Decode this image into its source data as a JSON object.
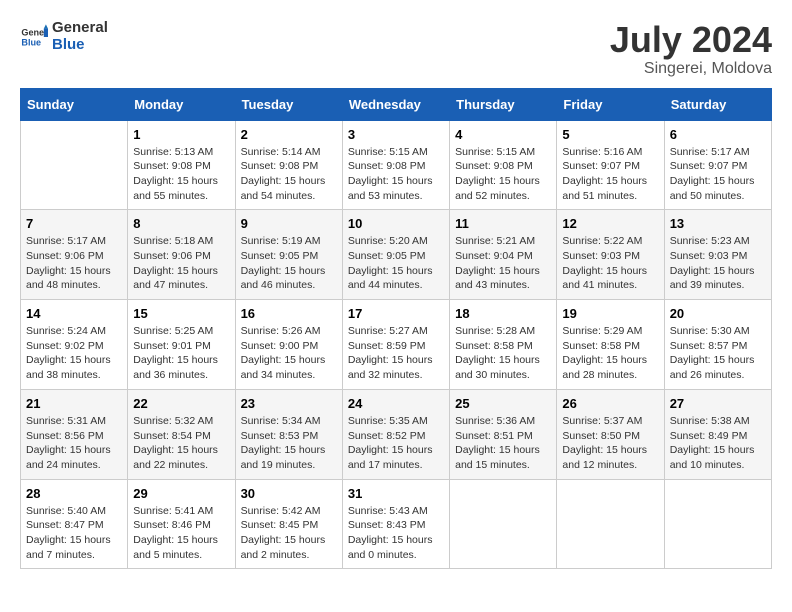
{
  "logo": {
    "general": "General",
    "blue": "Blue"
  },
  "title": "July 2024",
  "subtitle": "Singerei, Moldova",
  "days_header": [
    "Sunday",
    "Monday",
    "Tuesday",
    "Wednesday",
    "Thursday",
    "Friday",
    "Saturday"
  ],
  "weeks": [
    [
      {
        "day": "",
        "info": ""
      },
      {
        "day": "1",
        "info": "Sunrise: 5:13 AM\nSunset: 9:08 PM\nDaylight: 15 hours\nand 55 minutes."
      },
      {
        "day": "2",
        "info": "Sunrise: 5:14 AM\nSunset: 9:08 PM\nDaylight: 15 hours\nand 54 minutes."
      },
      {
        "day": "3",
        "info": "Sunrise: 5:15 AM\nSunset: 9:08 PM\nDaylight: 15 hours\nand 53 minutes."
      },
      {
        "day": "4",
        "info": "Sunrise: 5:15 AM\nSunset: 9:08 PM\nDaylight: 15 hours\nand 52 minutes."
      },
      {
        "day": "5",
        "info": "Sunrise: 5:16 AM\nSunset: 9:07 PM\nDaylight: 15 hours\nand 51 minutes."
      },
      {
        "day": "6",
        "info": "Sunrise: 5:17 AM\nSunset: 9:07 PM\nDaylight: 15 hours\nand 50 minutes."
      }
    ],
    [
      {
        "day": "7",
        "info": "Sunrise: 5:17 AM\nSunset: 9:06 PM\nDaylight: 15 hours\nand 48 minutes."
      },
      {
        "day": "8",
        "info": "Sunrise: 5:18 AM\nSunset: 9:06 PM\nDaylight: 15 hours\nand 47 minutes."
      },
      {
        "day": "9",
        "info": "Sunrise: 5:19 AM\nSunset: 9:05 PM\nDaylight: 15 hours\nand 46 minutes."
      },
      {
        "day": "10",
        "info": "Sunrise: 5:20 AM\nSunset: 9:05 PM\nDaylight: 15 hours\nand 44 minutes."
      },
      {
        "day": "11",
        "info": "Sunrise: 5:21 AM\nSunset: 9:04 PM\nDaylight: 15 hours\nand 43 minutes."
      },
      {
        "day": "12",
        "info": "Sunrise: 5:22 AM\nSunset: 9:03 PM\nDaylight: 15 hours\nand 41 minutes."
      },
      {
        "day": "13",
        "info": "Sunrise: 5:23 AM\nSunset: 9:03 PM\nDaylight: 15 hours\nand 39 minutes."
      }
    ],
    [
      {
        "day": "14",
        "info": "Sunrise: 5:24 AM\nSunset: 9:02 PM\nDaylight: 15 hours\nand 38 minutes."
      },
      {
        "day": "15",
        "info": "Sunrise: 5:25 AM\nSunset: 9:01 PM\nDaylight: 15 hours\nand 36 minutes."
      },
      {
        "day": "16",
        "info": "Sunrise: 5:26 AM\nSunset: 9:00 PM\nDaylight: 15 hours\nand 34 minutes."
      },
      {
        "day": "17",
        "info": "Sunrise: 5:27 AM\nSunset: 8:59 PM\nDaylight: 15 hours\nand 32 minutes."
      },
      {
        "day": "18",
        "info": "Sunrise: 5:28 AM\nSunset: 8:58 PM\nDaylight: 15 hours\nand 30 minutes."
      },
      {
        "day": "19",
        "info": "Sunrise: 5:29 AM\nSunset: 8:58 PM\nDaylight: 15 hours\nand 28 minutes."
      },
      {
        "day": "20",
        "info": "Sunrise: 5:30 AM\nSunset: 8:57 PM\nDaylight: 15 hours\nand 26 minutes."
      }
    ],
    [
      {
        "day": "21",
        "info": "Sunrise: 5:31 AM\nSunset: 8:56 PM\nDaylight: 15 hours\nand 24 minutes."
      },
      {
        "day": "22",
        "info": "Sunrise: 5:32 AM\nSunset: 8:54 PM\nDaylight: 15 hours\nand 22 minutes."
      },
      {
        "day": "23",
        "info": "Sunrise: 5:34 AM\nSunset: 8:53 PM\nDaylight: 15 hours\nand 19 minutes."
      },
      {
        "day": "24",
        "info": "Sunrise: 5:35 AM\nSunset: 8:52 PM\nDaylight: 15 hours\nand 17 minutes."
      },
      {
        "day": "25",
        "info": "Sunrise: 5:36 AM\nSunset: 8:51 PM\nDaylight: 15 hours\nand 15 minutes."
      },
      {
        "day": "26",
        "info": "Sunrise: 5:37 AM\nSunset: 8:50 PM\nDaylight: 15 hours\nand 12 minutes."
      },
      {
        "day": "27",
        "info": "Sunrise: 5:38 AM\nSunset: 8:49 PM\nDaylight: 15 hours\nand 10 minutes."
      }
    ],
    [
      {
        "day": "28",
        "info": "Sunrise: 5:40 AM\nSunset: 8:47 PM\nDaylight: 15 hours\nand 7 minutes."
      },
      {
        "day": "29",
        "info": "Sunrise: 5:41 AM\nSunset: 8:46 PM\nDaylight: 15 hours\nand 5 minutes."
      },
      {
        "day": "30",
        "info": "Sunrise: 5:42 AM\nSunset: 8:45 PM\nDaylight: 15 hours\nand 2 minutes."
      },
      {
        "day": "31",
        "info": "Sunrise: 5:43 AM\nSunset: 8:43 PM\nDaylight: 15 hours\nand 0 minutes."
      },
      {
        "day": "",
        "info": ""
      },
      {
        "day": "",
        "info": ""
      },
      {
        "day": "",
        "info": ""
      }
    ]
  ]
}
